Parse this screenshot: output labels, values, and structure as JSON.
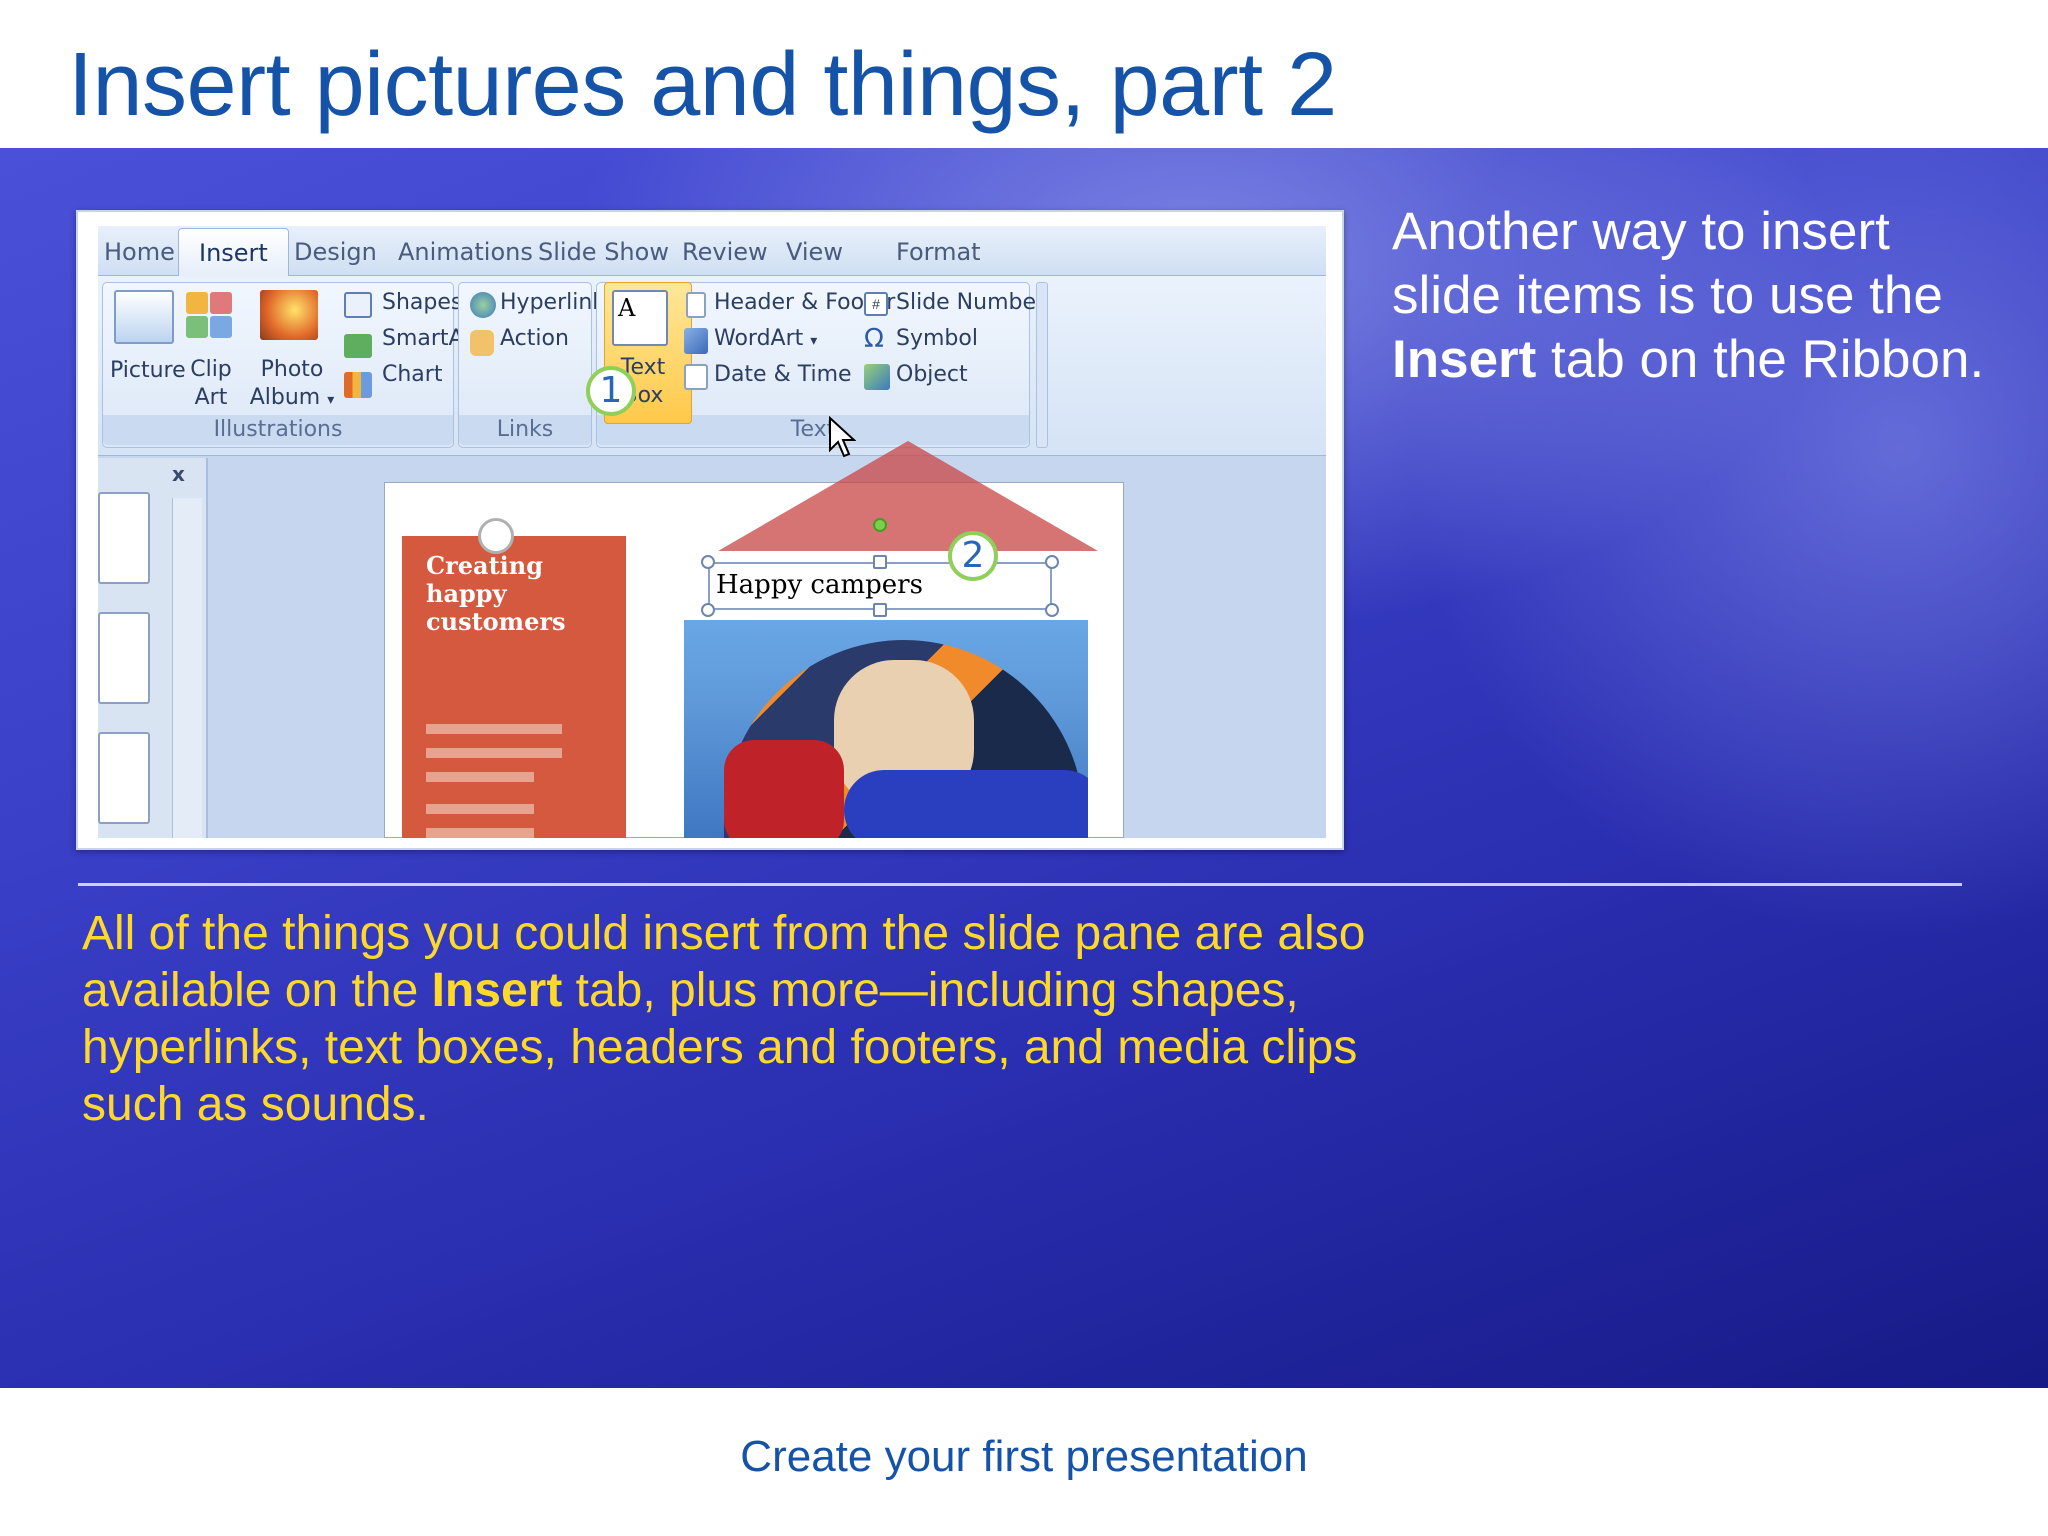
{
  "slide": {
    "title": "Insert pictures and things, part 2",
    "footer": "Create your first presentation",
    "side_text_parts": [
      "Another way to insert slide items is to use the ",
      "Insert",
      " tab on the Ribbon."
    ],
    "bottom_text_parts": [
      "All of the things you could insert from the slide pane are also available on the ",
      "Insert",
      " tab, plus more—including shapes, hyperlinks, text boxes, headers and footers, and media clips such as sounds."
    ]
  },
  "ribbon": {
    "tabs": [
      "Home",
      "Insert",
      "Design",
      "Animations",
      "Slide Show",
      "Review",
      "View",
      "Format"
    ],
    "active_tab": "Insert",
    "groups": {
      "illustrations": {
        "label": "Illustrations",
        "picture": "Picture",
        "clip_art_1": "Clip",
        "clip_art_2": "Art",
        "photo_album_1": "Photo",
        "photo_album_2": "Album",
        "shapes": "Shapes",
        "smartart": "SmartArt",
        "chart": "Chart"
      },
      "links": {
        "label": "Links",
        "hyperlink": "Hyperlink",
        "action": "Action"
      },
      "text": {
        "label": "Text",
        "text_box_1": "Text",
        "text_box_2": "Box",
        "header_footer": "Header & Footer",
        "wordart": "WordArt",
        "date_time": "Date & Time",
        "slide_number": "Slide Number",
        "symbol": "Symbol",
        "object": "Object"
      }
    }
  },
  "callouts": {
    "one": "1",
    "two": "2"
  },
  "slide_content": {
    "panel_text": [
      "Creating",
      "happy",
      "customers"
    ],
    "caption": "Happy campers",
    "pane_close": "x"
  },
  "colors": {
    "title_blue": "#1553a8",
    "bottom_text": "#ffd92a",
    "highlight": "#ffc94a",
    "callout_ring": "#8fcf5a"
  }
}
